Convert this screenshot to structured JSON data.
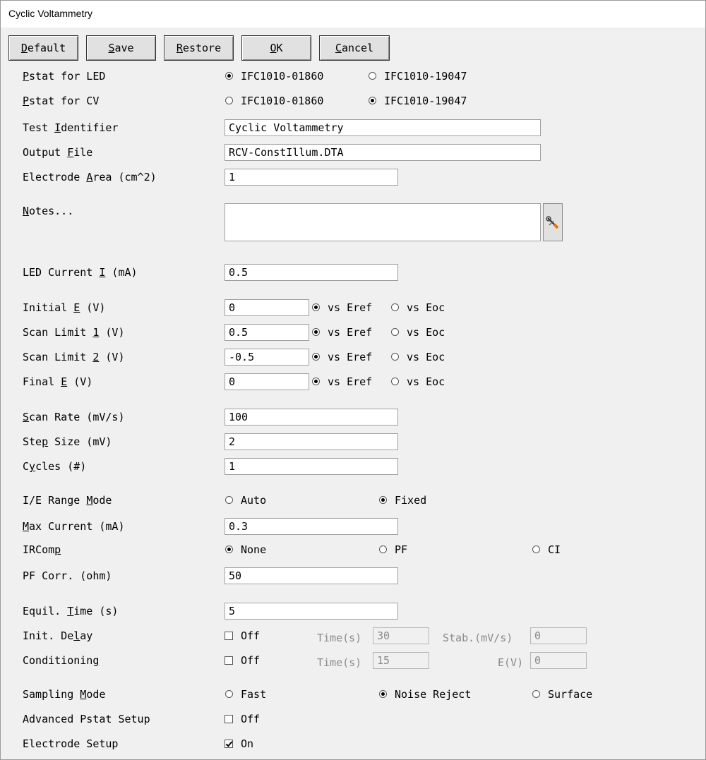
{
  "window": {
    "title": "Cyclic Voltammetry"
  },
  "buttons": {
    "default": {
      "first": "D",
      "rest": "efault"
    },
    "save": {
      "first": "S",
      "rest": "ave"
    },
    "restore": {
      "first": "R",
      "rest": "estore"
    },
    "ok": {
      "first": "O",
      "rest": "K"
    },
    "cancel": {
      "first": "C",
      "rest": "ancel"
    }
  },
  "pstat_led": {
    "label_pre": "",
    "label_key": "P",
    "label_post": "stat for LED",
    "options": [
      "IFC1010-01860",
      "IFC1010-19047"
    ],
    "selected": 0
  },
  "pstat_cv": {
    "label_pre": "",
    "label_key": "P",
    "label_post": "stat for CV",
    "options": [
      "IFC1010-01860",
      "IFC1010-19047"
    ],
    "selected": 1
  },
  "test_identifier": {
    "label_pre": "Test ",
    "label_key": "I",
    "label_post": "dentifier",
    "value": "Cyclic Voltammetry"
  },
  "output_file": {
    "label_pre": "Output ",
    "label_key": "F",
    "label_post": "ile",
    "value": "RCV-ConstIllum.DTA"
  },
  "electrode_area": {
    "label_pre": "Electrode ",
    "label_key": "A",
    "label_post": "rea (cm^2)",
    "value": "1"
  },
  "notes": {
    "label_pre": "",
    "label_key": "N",
    "label_post": "otes...",
    "value": ""
  },
  "led_current": {
    "label_pre": "LED Current ",
    "label_key": "I",
    "label_post": " (mA)",
    "value": "0.5"
  },
  "potentials": [
    {
      "label_pre": "Initial ",
      "label_key": "E",
      "label_post": " (V)",
      "value": "0",
      "vs": [
        "vs Eref",
        "vs Eoc"
      ],
      "selected": 0
    },
    {
      "label_pre": "Scan Limit ",
      "label_key": "1",
      "label_post": " (V)",
      "value": "0.5",
      "vs": [
        "vs Eref",
        "vs Eoc"
      ],
      "selected": 0
    },
    {
      "label_pre": "Scan Limit ",
      "label_key": "2",
      "label_post": " (V)",
      "value": "-0.5",
      "vs": [
        "vs Eref",
        "vs Eoc"
      ],
      "selected": 0
    },
    {
      "label_pre": "Final ",
      "label_key": "E",
      "label_post": " (V)",
      "value": "0",
      "vs": [
        "vs Eref",
        "vs Eoc"
      ],
      "selected": 0
    }
  ],
  "scan_rate": {
    "label_pre": "",
    "label_key": "S",
    "label_post": "can Rate (mV/s)",
    "value": "100"
  },
  "step_size": {
    "label_pre": "Ste",
    "label_key": "p",
    "label_post": " Size (mV)",
    "value": "2"
  },
  "cycles": {
    "label_pre": "C",
    "label_key": "y",
    "label_post": "cles (#)",
    "value": "1"
  },
  "ie_range_mode": {
    "label_pre": "I/E Range ",
    "label_key": "M",
    "label_post": "ode",
    "options": [
      "Auto",
      "Fixed"
    ],
    "selected": 1
  },
  "max_current": {
    "label_pre": "",
    "label_key": "M",
    "label_post": "ax Current (mA)",
    "value": "0.3"
  },
  "ircomp": {
    "label_pre": "IRCom",
    "label_key": "p",
    "label_post": "",
    "options": [
      "None",
      "PF",
      "CI"
    ],
    "selected": 0
  },
  "pf_corr": {
    "label": "PF Corr. (ohm)",
    "value": "50"
  },
  "equil_time": {
    "label_pre": "Equil. ",
    "label_key": "T",
    "label_post": "ime (s)",
    "value": "5"
  },
  "init_delay": {
    "label_pre": "Init. De",
    "label_key": "l",
    "label_post": "ay",
    "check_label": "Off",
    "checked": false,
    "time_label": "Time(s)",
    "time_value": "30",
    "stab_label": "Stab.(mV/s)",
    "stab_value": "0"
  },
  "conditioning": {
    "label_pre": "Conditionin",
    "label_key": "g",
    "label_post": "",
    "check_label": "Off",
    "checked": false,
    "time_label": "Time(s)",
    "time_value": "15",
    "e_label": "E(V)",
    "e_value": "0"
  },
  "sampling_mode": {
    "label_pre": "Sampling ",
    "label_key": "M",
    "label_post": "ode",
    "options": [
      "Fast",
      "Noise Reject",
      "Surface"
    ],
    "selected": 1
  },
  "advanced_pstat": {
    "label": "Advanced Pstat Setup",
    "check_label": "Off",
    "checked": false
  },
  "electrode_setup": {
    "label": "Electrode Setup",
    "check_label": "On",
    "checked": true
  },
  "icons": {
    "notes_button": "wrench-screwdriver-icon"
  }
}
